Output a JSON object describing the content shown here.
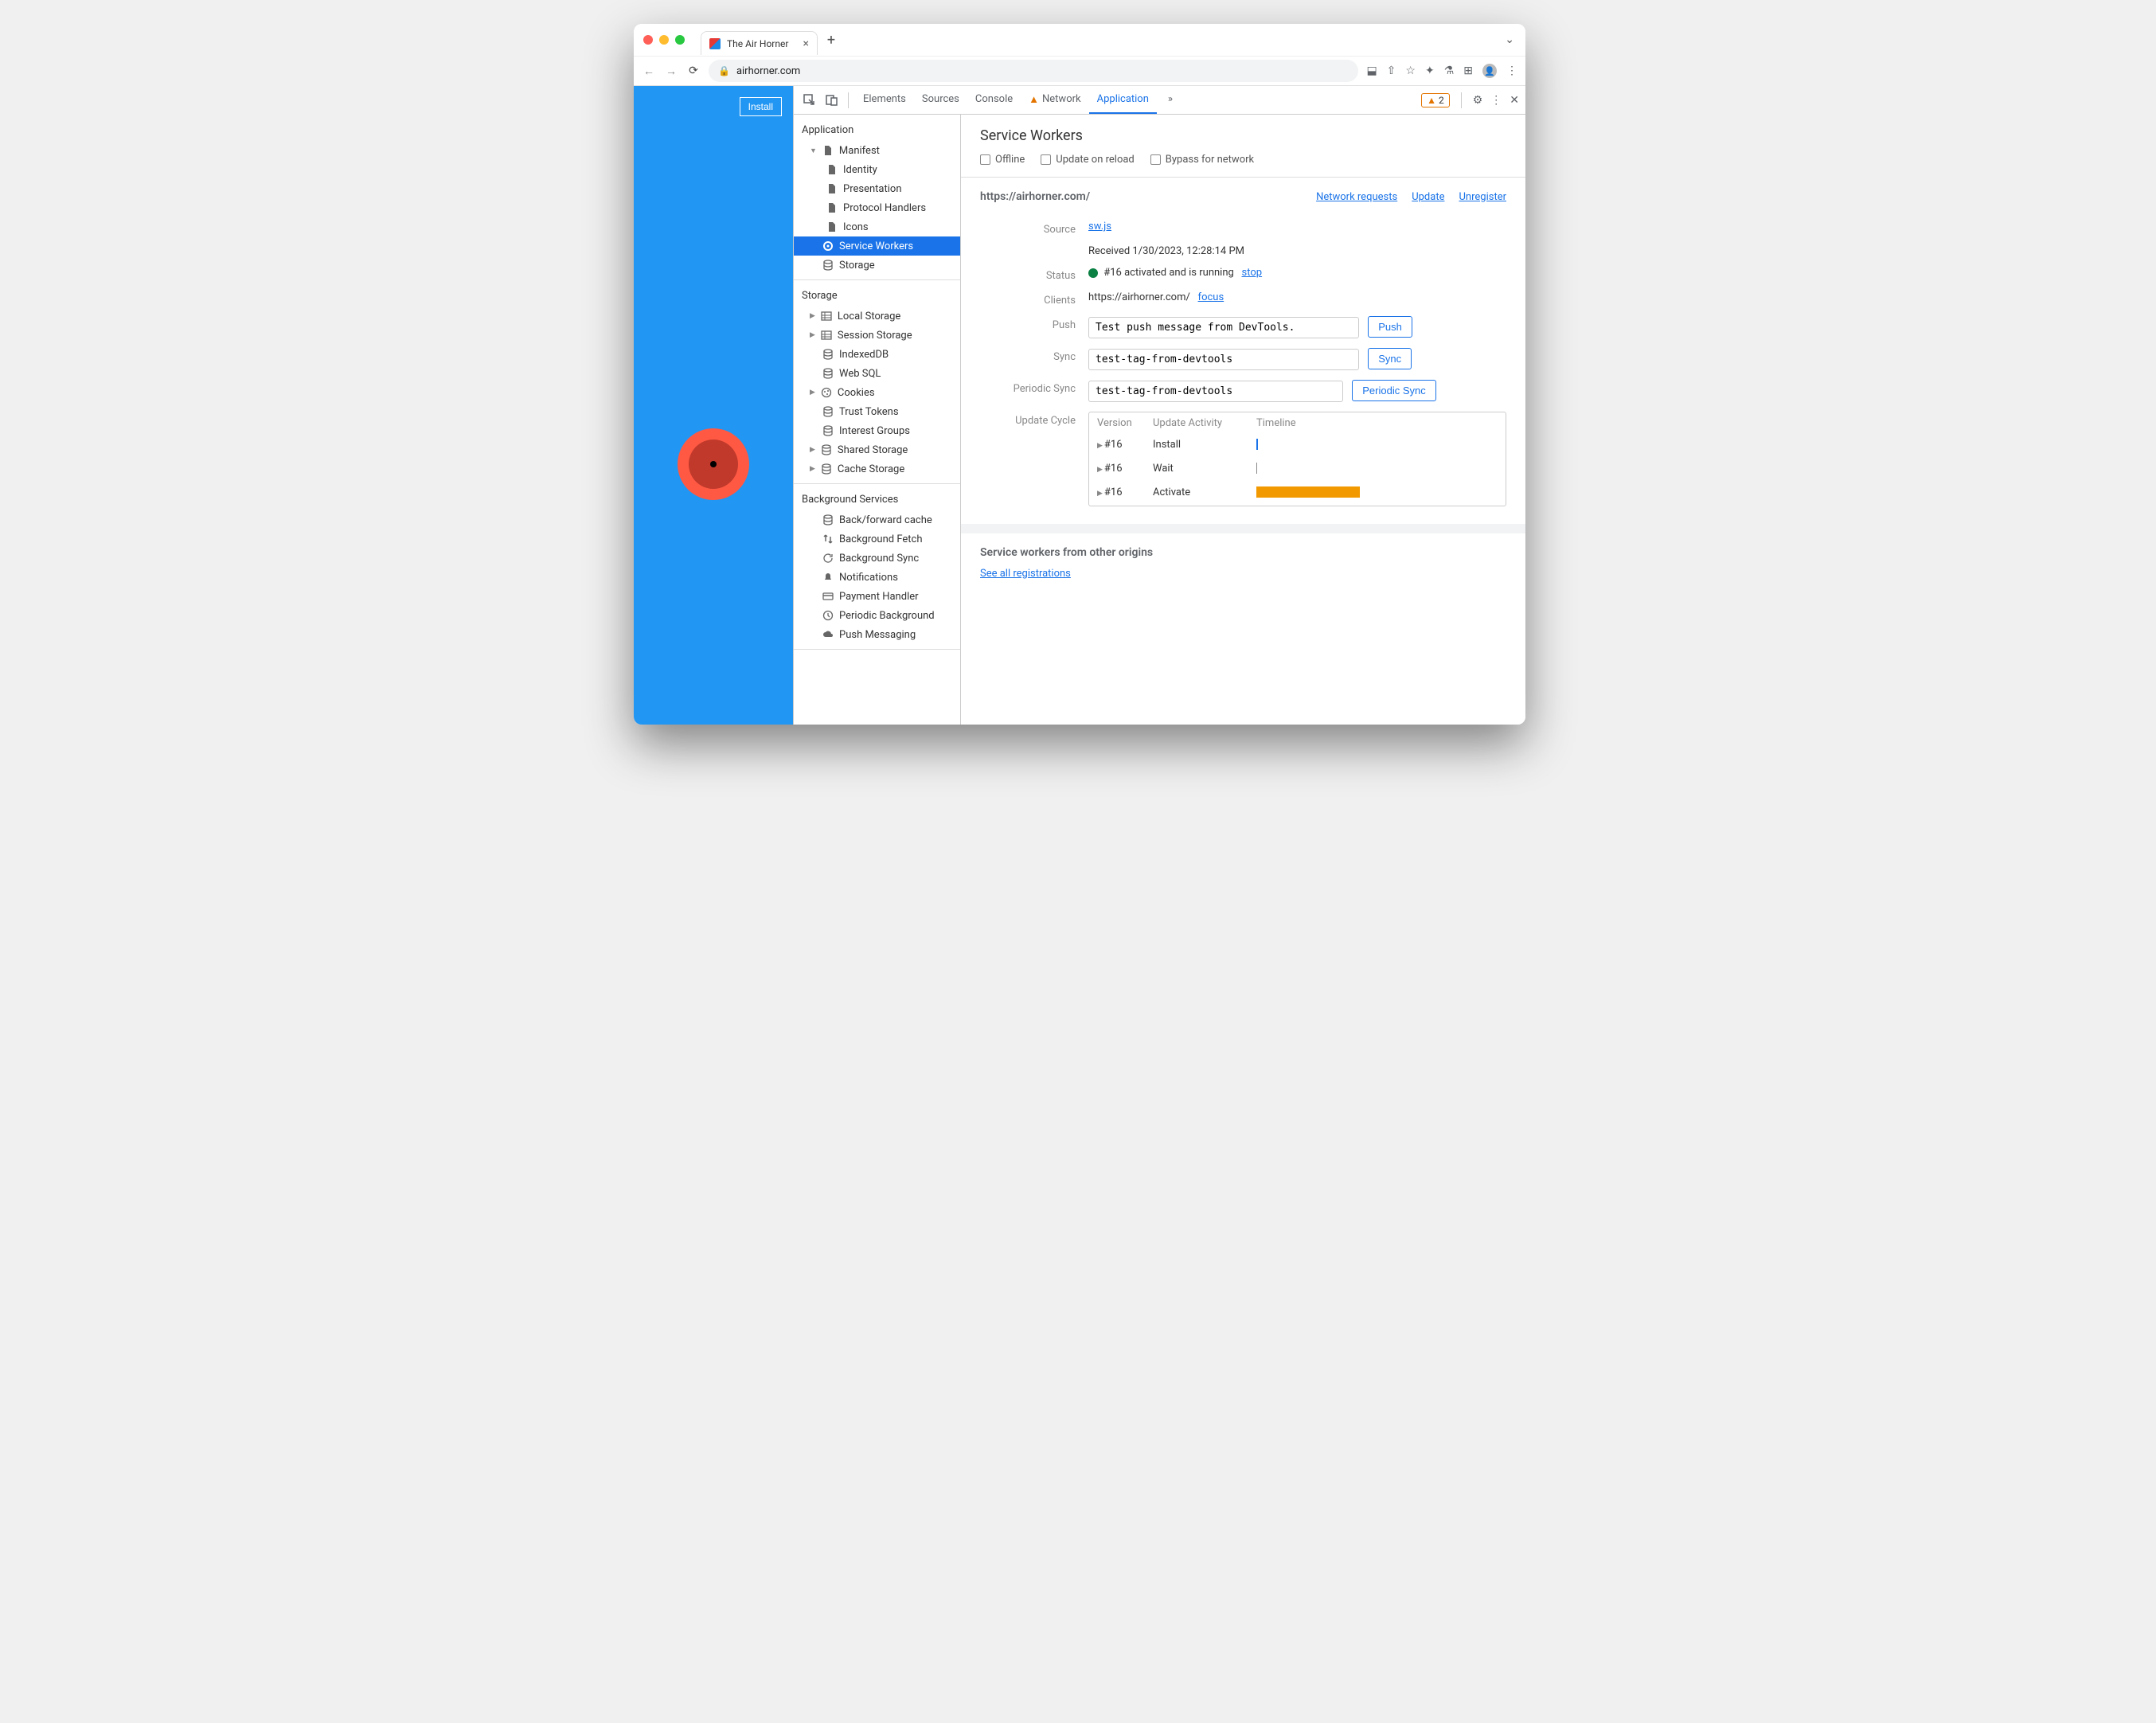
{
  "browser": {
    "tab_title": "The Air Horner",
    "url": "airhorner.com"
  },
  "page": {
    "install_label": "Install"
  },
  "devtools": {
    "tabs": [
      "Elements",
      "Sources",
      "Console",
      "Network",
      "Application"
    ],
    "active_tab": "Application",
    "network_warning": true,
    "warning_count": "2"
  },
  "sidebar": {
    "sections": [
      {
        "title": "Application",
        "items": [
          {
            "label": "Manifest",
            "icon": "file",
            "expandable": true,
            "expanded": true,
            "children": [
              {
                "label": "Identity",
                "icon": "file"
              },
              {
                "label": "Presentation",
                "icon": "file"
              },
              {
                "label": "Protocol Handlers",
                "icon": "file"
              },
              {
                "label": "Icons",
                "icon": "file"
              }
            ]
          },
          {
            "label": "Service Workers",
            "icon": "gear",
            "selected": true
          },
          {
            "label": "Storage",
            "icon": "db"
          }
        ]
      },
      {
        "title": "Storage",
        "items": [
          {
            "label": "Local Storage",
            "icon": "table",
            "expandable": true
          },
          {
            "label": "Session Storage",
            "icon": "table",
            "expandable": true
          },
          {
            "label": "IndexedDB",
            "icon": "db"
          },
          {
            "label": "Web SQL",
            "icon": "db"
          },
          {
            "label": "Cookies",
            "icon": "cookie",
            "expandable": true
          },
          {
            "label": "Trust Tokens",
            "icon": "db"
          },
          {
            "label": "Interest Groups",
            "icon": "db"
          },
          {
            "label": "Shared Storage",
            "icon": "db",
            "expandable": true
          },
          {
            "label": "Cache Storage",
            "icon": "db",
            "expandable": true
          }
        ]
      },
      {
        "title": "Background Services",
        "items": [
          {
            "label": "Back/forward cache",
            "icon": "db"
          },
          {
            "label": "Background Fetch",
            "icon": "updown"
          },
          {
            "label": "Background Sync",
            "icon": "sync"
          },
          {
            "label": "Notifications",
            "icon": "bell"
          },
          {
            "label": "Payment Handler",
            "icon": "card"
          },
          {
            "label": "Periodic Background",
            "icon": "clock"
          },
          {
            "label": "Push Messaging",
            "icon": "cloud"
          }
        ]
      }
    ]
  },
  "detail": {
    "title": "Service Workers",
    "checks": [
      "Offline",
      "Update on reload",
      "Bypass for network"
    ],
    "origin": "https://airhorner.com/",
    "header_links": [
      "Network requests",
      "Update",
      "Unregister"
    ],
    "source": {
      "label": "Source",
      "file": "sw.js",
      "received": "Received 1/30/2023, 12:28:14 PM"
    },
    "status": {
      "label": "Status",
      "text": "#16 activated and is running",
      "action": "stop"
    },
    "clients": {
      "label": "Clients",
      "url": "https://airhorner.com/",
      "action": "focus"
    },
    "push": {
      "label": "Push",
      "value": "Test push message from DevTools.",
      "button": "Push"
    },
    "sync": {
      "label": "Sync",
      "value": "test-tag-from-devtools",
      "button": "Sync"
    },
    "psync": {
      "label": "Periodic Sync",
      "value": "test-tag-from-devtools",
      "button": "Periodic Sync"
    },
    "cycle": {
      "label": "Update Cycle",
      "headers": [
        "Version",
        "Update Activity",
        "Timeline"
      ],
      "rows": [
        {
          "v": "#16",
          "a": "Install",
          "t": "short"
        },
        {
          "v": "#16",
          "a": "Wait",
          "t": "thin"
        },
        {
          "v": "#16",
          "a": "Activate",
          "t": "bar"
        }
      ]
    },
    "other": {
      "title": "Service workers from other origins",
      "link": "See all registrations"
    }
  }
}
